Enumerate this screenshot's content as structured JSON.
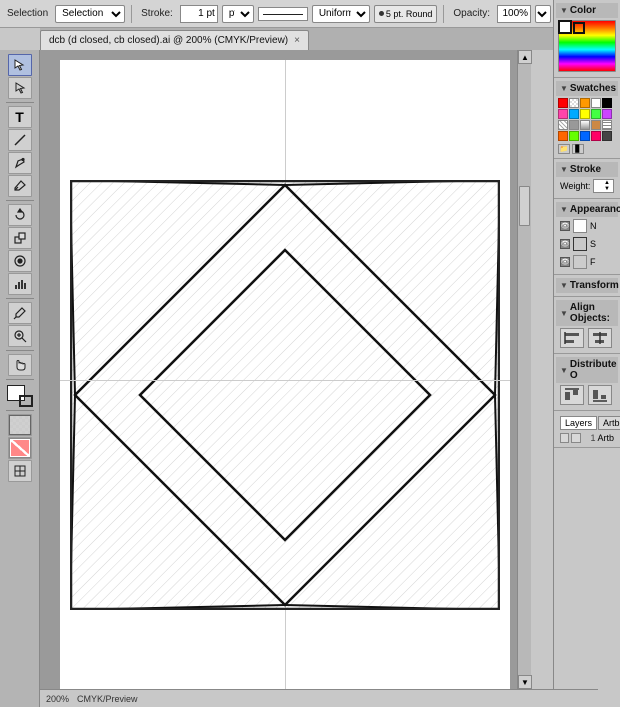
{
  "toolbar": {
    "selection_label": "Selection",
    "stroke_label": "Stroke:",
    "stroke_weight": "1 pt",
    "stroke_style": "Uniform",
    "cap_label": "5 pt. Round",
    "opacity_label": "Opacity:",
    "opacity_value": "100%"
  },
  "tab": {
    "title": "dcb (d closed, cb closed).ai @ 200% (CMYK/Preview)",
    "close": "×"
  },
  "tools": [
    {
      "name": "selection",
      "icon": "↖",
      "active": true
    },
    {
      "name": "direct-selection",
      "icon": "↗"
    },
    {
      "name": "type",
      "icon": "T"
    },
    {
      "name": "line",
      "icon": "/"
    },
    {
      "name": "pencil",
      "icon": "✏"
    },
    {
      "name": "brush",
      "icon": "✦"
    },
    {
      "name": "rotate-warp",
      "icon": "⟳"
    },
    {
      "name": "scale",
      "icon": "⤢"
    },
    {
      "name": "symbol",
      "icon": "⊕"
    },
    {
      "name": "bar-graph",
      "icon": "▊"
    },
    {
      "name": "eyedropper",
      "icon": "✒"
    },
    {
      "name": "zoom",
      "icon": "🔍"
    },
    {
      "name": "hand",
      "icon": "✋"
    },
    {
      "name": "artboard",
      "icon": "⊞"
    }
  ],
  "right_panel": {
    "color_section": "Color",
    "swatches_section": "Swatches",
    "stroke_section": "Stroke",
    "stroke_weight_label": "Weight:",
    "stroke_weight_value": "",
    "appearance_section": "Appearance",
    "appearance_item1": "N",
    "appearance_item2": "S",
    "appearance_item3": "F",
    "transform_section": "Transform",
    "align_section": "Align Objects:",
    "distribute_section": "Distribute O",
    "layers_section": "Layers",
    "artboard_section": "Artb",
    "layer_num": "1",
    "layer_name": "Artb"
  },
  "swatches": [
    "#ff0000",
    "#ff7f00",
    "#ffff00",
    "#00ff00",
    "#00ffff",
    "#0000ff",
    "#8b00ff",
    "#ff69b4",
    "#ffffff",
    "#000000",
    "#ff4444",
    "#ffaa44",
    "#ffff44",
    "#44ff44",
    "#44ffff",
    "#4444ff",
    "#cc44ff",
    "#ff44cc",
    "#cccccc",
    "#888888",
    "#cc0000",
    "#cc7700",
    "#cccc00",
    "#00cc00",
    "#00cccc",
    "#0000cc",
    "#7700cc",
    "#cc0077",
    "#444444",
    "#222222",
    "#ffcccc",
    "#ffeecc",
    "#ffffcc",
    "#ccffcc",
    "#ccffff",
    "#ccccff",
    "#eeccff",
    "#ffccee",
    "#eeeeee",
    "#111111"
  ],
  "document": {
    "zoom": "200%",
    "mode": "CMYK/Preview"
  }
}
